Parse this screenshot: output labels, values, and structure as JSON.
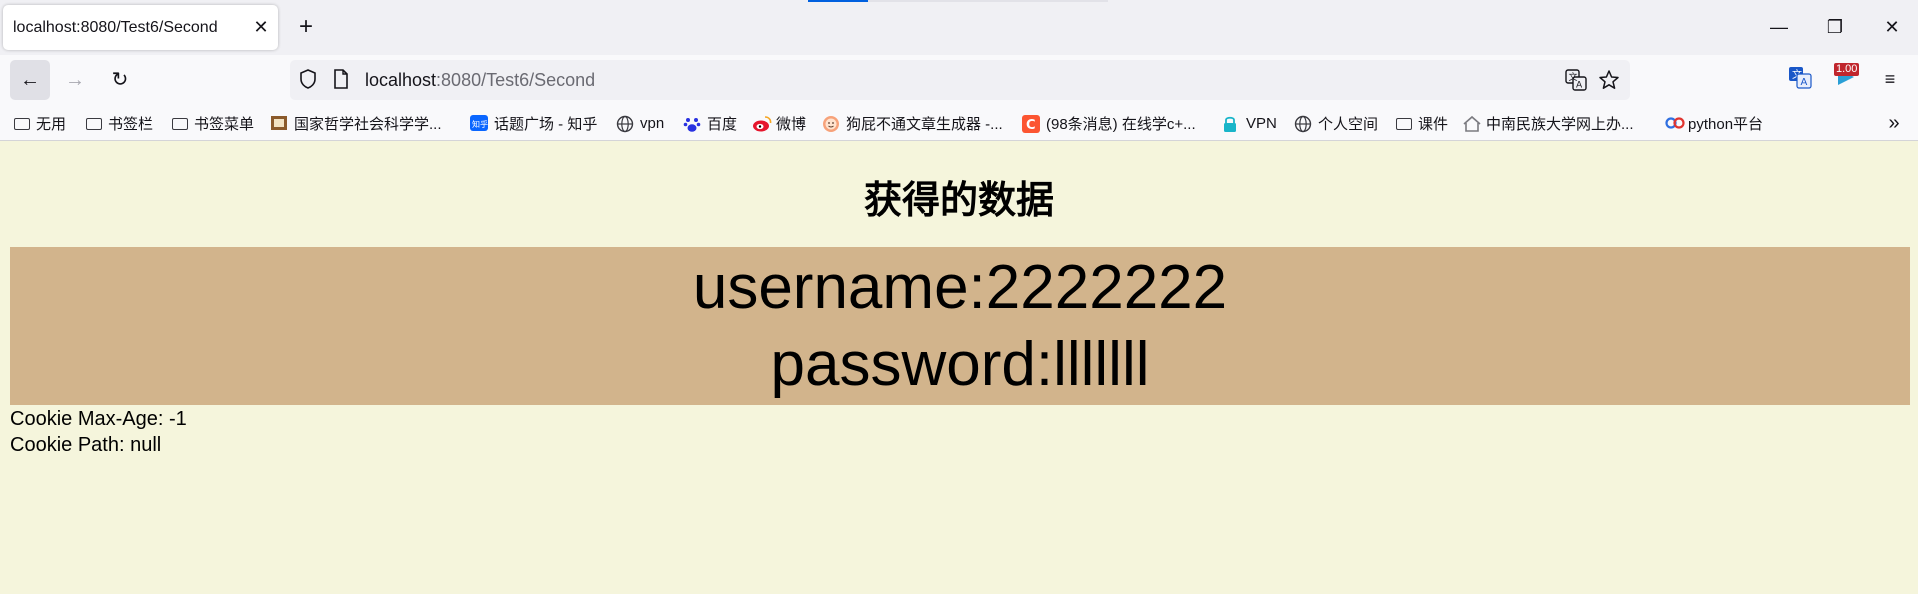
{
  "tab": {
    "title": "localhost:8080/Test6/Second",
    "close_glyph": "✕",
    "new_tab_glyph": "+"
  },
  "window_controls": {
    "minimize_glyph": "—",
    "restore_glyph": "❐",
    "close_glyph": "✕"
  },
  "nav": {
    "back_glyph": "←",
    "forward_glyph": "→",
    "reload_glyph": "↻",
    "url_host": "localhost",
    "url_rest": ":8080/Test6/Second",
    "shield_icon": "shield-icon",
    "page_icon": "page-icon",
    "translate_icon": "translate-icon",
    "star_icon": "star-icon",
    "extension_badge": "1.00",
    "menu_glyph": "≡"
  },
  "bookmarks": {
    "items": [
      {
        "label": "无用",
        "icon": "folder-icon"
      },
      {
        "label": "书签栏",
        "icon": "folder-icon"
      },
      {
        "label": "书签菜单",
        "icon": "folder-icon"
      },
      {
        "label": "国家哲学社会科学学...",
        "icon": "site-icon"
      },
      {
        "label": "话题广场 - 知乎",
        "icon": "zhihu-icon"
      },
      {
        "label": "vpn",
        "icon": "globe-icon"
      },
      {
        "label": "百度",
        "icon": "baidu-icon"
      },
      {
        "label": "微博",
        "icon": "weibo-icon"
      },
      {
        "label": "狗屁不通文章生成器 -...",
        "icon": "face-icon"
      },
      {
        "label": "(98条消息) 在线学c+...",
        "icon": "csdn-icon"
      },
      {
        "label": "VPN",
        "icon": "lock-icon"
      },
      {
        "label": "个人空间",
        "icon": "globe-icon"
      },
      {
        "label": "课件",
        "icon": "folder-icon"
      },
      {
        "label": "中南民族大学网上办...",
        "icon": "home-icon"
      },
      {
        "label": "python平台",
        "icon": "link-icon"
      }
    ],
    "overflow_glyph": "»"
  },
  "page": {
    "heading": "获得的数据",
    "username_line": "username:2222222",
    "password_line": "password:lllllll",
    "cookie_max_age": "Cookie Max-Age: -1",
    "cookie_path": "Cookie Path: null"
  },
  "colors": {
    "page_background": "#f5f5dc",
    "data_box_background": "#d2b48c",
    "accent": "#0060df"
  }
}
